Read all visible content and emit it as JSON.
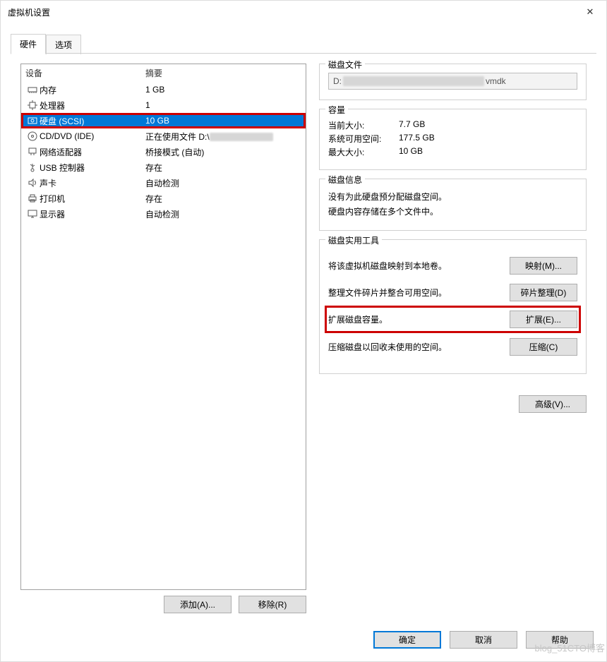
{
  "window": {
    "title": "虚拟机设置",
    "close_label": "✕"
  },
  "tabs": {
    "hardware": "硬件",
    "options": "选项"
  },
  "list": {
    "col_device": "设备",
    "col_summary": "摘要",
    "rows": [
      {
        "name": "内存",
        "summary": "1 GB"
      },
      {
        "name": "处理器",
        "summary": "1"
      },
      {
        "name": "硬盘 (SCSI)",
        "summary": "10 GB"
      },
      {
        "name": "CD/DVD (IDE)",
        "summary": "正在使用文件 D:\\"
      },
      {
        "name": "网络适配器",
        "summary": "桥接模式 (自动)"
      },
      {
        "name": "USB 控制器",
        "summary": "存在"
      },
      {
        "name": "声卡",
        "summary": "自动检测"
      },
      {
        "name": "打印机",
        "summary": "存在"
      },
      {
        "name": "显示器",
        "summary": "自动检测"
      }
    ]
  },
  "diskfile": {
    "title": "磁盘文件",
    "prefix": "D:",
    "suffix": "vmdk"
  },
  "capacity": {
    "title": "容量",
    "current_label": "当前大小:",
    "current_value": "7.7 GB",
    "free_label": "系统可用空间:",
    "free_value": "177.5 GB",
    "max_label": "最大大小:",
    "max_value": "10 GB"
  },
  "diskinfo": {
    "title": "磁盘信息",
    "line1": "没有为此硬盘预分配磁盘空间。",
    "line2": "硬盘内容存储在多个文件中。"
  },
  "utils": {
    "title": "磁盘实用工具",
    "map_desc": "将该虚拟机磁盘映射到本地卷。",
    "map_btn": "映射(M)...",
    "defrag_desc": "整理文件碎片并整合可用空间。",
    "defrag_btn": "碎片整理(D)",
    "expand_desc": "扩展磁盘容量。",
    "expand_btn": "扩展(E)...",
    "compact_desc": "压缩磁盘以回收未使用的空间。",
    "compact_btn": "压缩(C)",
    "advanced_btn": "高级(V)..."
  },
  "bottom_left": {
    "add_btn": "添加(A)...",
    "remove_btn": "移除(R)"
  },
  "dialog": {
    "ok": "确定",
    "cancel": "取消",
    "help": "帮助"
  },
  "watermark": "blog_51CTO博客"
}
